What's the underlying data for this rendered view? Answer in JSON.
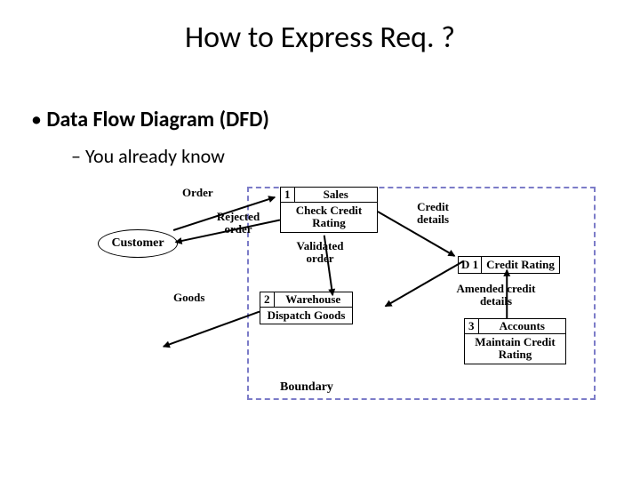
{
  "slide": {
    "title": "How to Express Req. ?",
    "bullet1": "Data Flow Diagram (DFD)",
    "bullet2": "You already know"
  },
  "dfd": {
    "external": {
      "customer": "Customer"
    },
    "processes": {
      "p1": {
        "num": "1",
        "title": "Sales",
        "body": "Check Credit Rating"
      },
      "p2": {
        "num": "2",
        "title": "Warehouse",
        "body": "Dispatch Goods"
      },
      "p3": {
        "num": "3",
        "title": "Accounts",
        "body": "Maintain Credit Rating"
      }
    },
    "datastore": {
      "d1": {
        "num": "D 1",
        "title": "Credit Rating"
      }
    },
    "flows": {
      "order": "Order",
      "rejected": "Rejected order",
      "validated": "Validated order",
      "goods": "Goods",
      "creditDetails": "Credit details",
      "amended": "Amended credit details"
    },
    "boundary": "Boundary"
  }
}
